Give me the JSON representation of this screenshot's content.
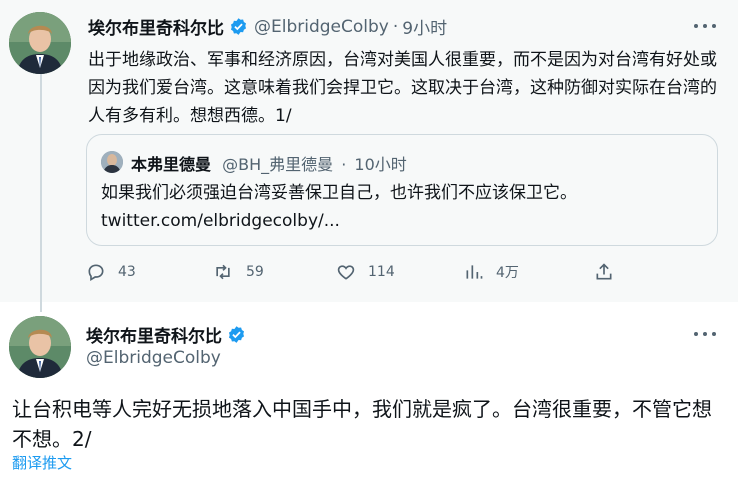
{
  "colors": {
    "accent": "#1d9bf0",
    "muted": "#536471",
    "text": "#0f1419",
    "thread_bg": "#f7f9f9"
  },
  "tweet1": {
    "author_name": "埃尔布里奇科尔比",
    "handle": "@ElbridgeColby",
    "separator": "·",
    "time": "9小时",
    "text": "出于地缘政治、军事和经济原因，台湾对美国人很重要，而不是因为对台湾有好处或因为我们爱台湾。这意味着我们会捍卫它。这取决于台湾，这种防御对实际在台湾的人有多有利。想想西德。1/",
    "quote": {
      "author_name": "本弗里德曼",
      "handle": "@BH_弗里德曼",
      "separator": "·",
      "time": "10小时",
      "text": "如果我们必须强迫台湾妥善保卫自己，也许我们不应该保卫它。",
      "link": "twitter.com/elbridgecolby/..."
    },
    "actions": {
      "reply_count": "43",
      "retweet_count": "59",
      "like_count": "114",
      "views_count": "4万"
    }
  },
  "tweet2": {
    "author_name": "埃尔布里奇科尔比",
    "handle": "@ElbridgeColby",
    "text": "让台积电等人完好无损地落入中国手中，我们就是疯了。台湾很重要，不管它想不想。2/",
    "translate_label": "翻译推文"
  },
  "icons": [
    "verified-badge-icon",
    "more-options-icon",
    "reply-icon",
    "retweet-icon",
    "like-icon",
    "views-icon",
    "share-icon"
  ]
}
